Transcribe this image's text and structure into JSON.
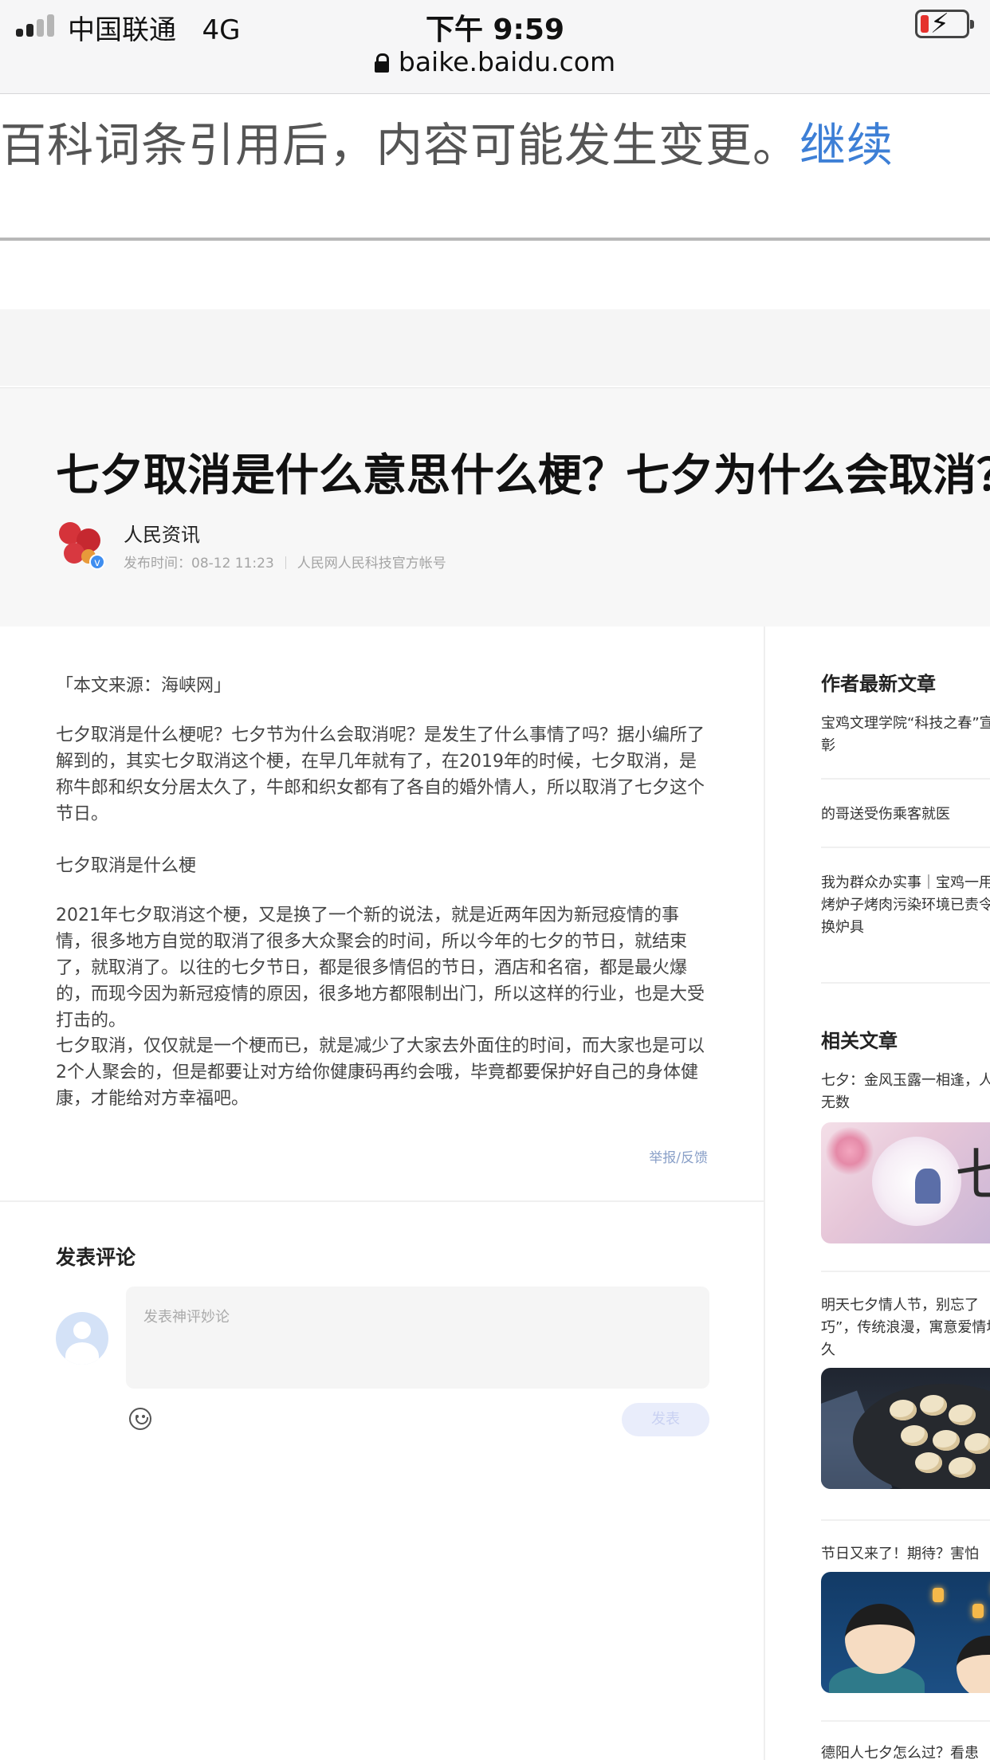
{
  "status_bar": {
    "carrier": "中国联通",
    "network": "4G",
    "time": "下午 9:59",
    "battery_level": "low",
    "battery_color": "#e5322d"
  },
  "url_bar": {
    "url": "baike.baidu.com"
  },
  "notice": {
    "text": "百科词条引用后，内容可能发生变更。",
    "continue_label": "继续",
    "link_color": "#3d7fd6"
  },
  "article": {
    "title": "七夕取消是什么意思什么梗？七夕为什么会取消？",
    "author": "人民资讯",
    "publish_time": "发布时间：08-12  11:23",
    "author_desc": "人民网人民科技官方帐号",
    "source": "「本文来源：海峡网」",
    "paragraphs": [
      "七夕取消是什么梗呢？七夕节为什么会取消呢？是发生了什么事情了吗？据小编所了解到的，其实七夕取消这个梗，在早几年就有了，在2019年的时候，七夕取消，是称牛郎和织女分居太久了，牛郎和织女都有了各自的婚外情人，所以取消了七夕这个节日。",
      "七夕取消是什么梗",
      "2021年七夕取消这个梗，又是换了一个新的说法，就是近两年因为新冠疫情的事情，很多地方自觉的取消了很多大众聚会的时间，所以今年的七夕的节日，就结束了，就取消了。以往的七夕节日，都是很多情侣的节日，酒店和名宿，都是最火爆的，而现今因为新冠疫情的原因，很多地方都限制出门，所以这样的行业，也是大受打击的。",
      "七夕取消，仅仅就是一个梗而已，就是减少了大家去外面住的时间，而大家也是可以2个人聚会的，但是都要让对方给你健康码再约会哦，毕竟都要保护好自己的身体健康，才能给对方幸福吧。"
    ],
    "report_label": "举报/反馈"
  },
  "comments": {
    "title": "发表评论",
    "placeholder": "发表神评妙论",
    "submit_label": "发表"
  },
  "sidebar": {
    "latest_title": "作者最新文章",
    "latest": [
      "宝鸡文理学院“科技之春”宣表彰",
      "的哥送受伤乘客就医",
      "我为群众办实事｜宝鸡一用碳烤炉子烤肉污染环境已责令更换炉具"
    ],
    "related_title": "相关文章",
    "related": [
      "七夕：金风玉露一相逢，人间无数",
      "明天七夕情人节，别忘了巧”，传统浪漫，寓意爱情地久",
      "节日又来了！期待？害怕",
      "德阳人七夕怎么过？看患"
    ]
  }
}
